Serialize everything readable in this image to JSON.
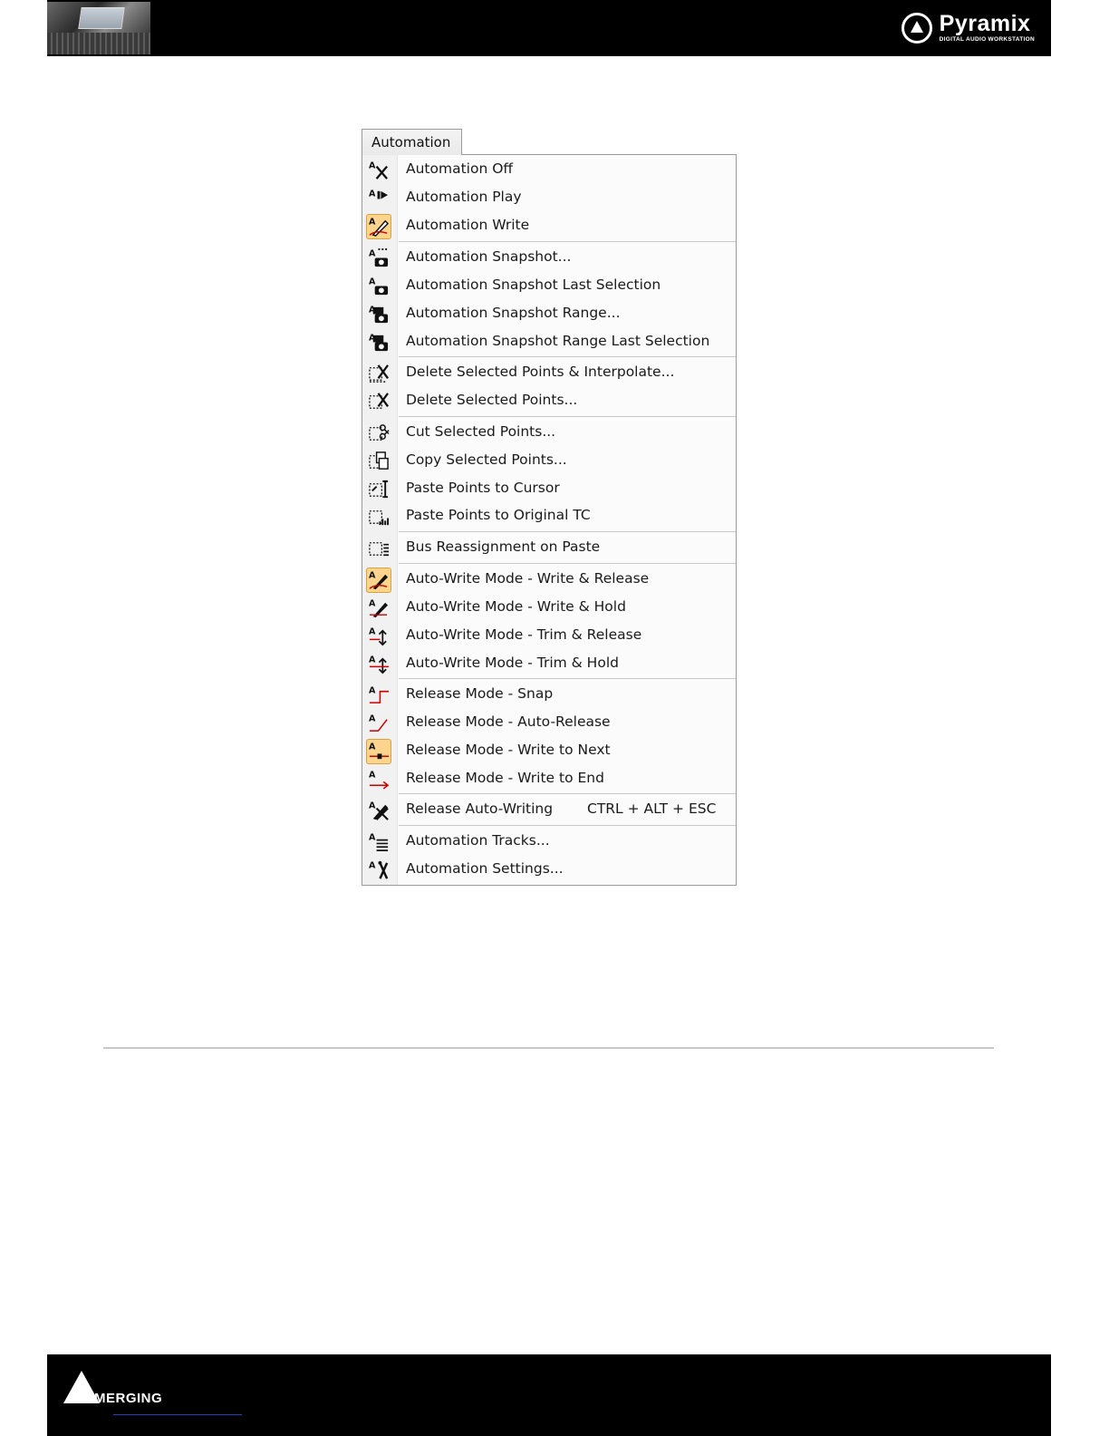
{
  "header": {
    "brand": "Pyramix",
    "brand_sub": "DIGITAL AUDIO WORKSTATION"
  },
  "menu": {
    "title": "Automation",
    "items": [
      {
        "label": "Automation Off",
        "icon": "automation-off-icon",
        "selected": false
      },
      {
        "label": "Automation Play",
        "icon": "automation-play-icon",
        "selected": false
      },
      {
        "label": "Automation Write",
        "icon": "automation-write-icon",
        "selected": true
      },
      {
        "label": "Automation Snapshot...",
        "icon": "snapshot-icon",
        "selected": false
      },
      {
        "label": "Automation Snapshot Last Selection",
        "icon": "snapshot-last-icon",
        "selected": false
      },
      {
        "label": "Automation Snapshot Range...",
        "icon": "snapshot-range-icon",
        "selected": false
      },
      {
        "label": "Automation Snapshot Range Last Selection",
        "icon": "snapshot-range-last-icon",
        "selected": false
      },
      {
        "label": "Delete Selected Points & Interpolate...",
        "icon": "delete-interpolate-icon",
        "selected": false
      },
      {
        "label": "Delete Selected Points...",
        "icon": "delete-points-icon",
        "selected": false
      },
      {
        "label": "Cut Selected Points...",
        "icon": "cut-points-icon",
        "selected": false
      },
      {
        "label": "Copy Selected Points...",
        "icon": "copy-points-icon",
        "selected": false
      },
      {
        "label": "Paste Points to Cursor",
        "icon": "paste-cursor-icon",
        "selected": false
      },
      {
        "label": "Paste Points to Original TC",
        "icon": "paste-original-icon",
        "selected": false
      },
      {
        "label": "Bus Reassignment on Paste",
        "icon": "bus-reassign-icon",
        "selected": false
      },
      {
        "label": "Auto-Write Mode - Write & Release",
        "icon": "write-release-icon",
        "selected": true
      },
      {
        "label": "Auto-Write Mode - Write & Hold",
        "icon": "write-hold-icon",
        "selected": false
      },
      {
        "label": "Auto-Write Mode - Trim & Release",
        "icon": "trim-release-icon",
        "selected": false
      },
      {
        "label": "Auto-Write Mode - Trim & Hold",
        "icon": "trim-hold-icon",
        "selected": false
      },
      {
        "label": "Release Mode - Snap",
        "icon": "release-snap-icon",
        "selected": false
      },
      {
        "label": "Release Mode - Auto-Release",
        "icon": "release-auto-icon",
        "selected": false
      },
      {
        "label": "Release Mode - Write to Next",
        "icon": "release-next-icon",
        "selected": true
      },
      {
        "label": "Release Mode - Write to End",
        "icon": "release-end-icon",
        "selected": false
      },
      {
        "label": "Release Auto-Writing",
        "icon": "release-writing-icon",
        "selected": false,
        "shortcut": "CTRL + ALT + ESC"
      },
      {
        "label": "Automation Tracks...",
        "icon": "automation-tracks-icon",
        "selected": false
      },
      {
        "label": "Automation Settings...",
        "icon": "automation-settings-icon",
        "selected": false
      }
    ]
  },
  "footer": {
    "brand": "MERGING"
  }
}
